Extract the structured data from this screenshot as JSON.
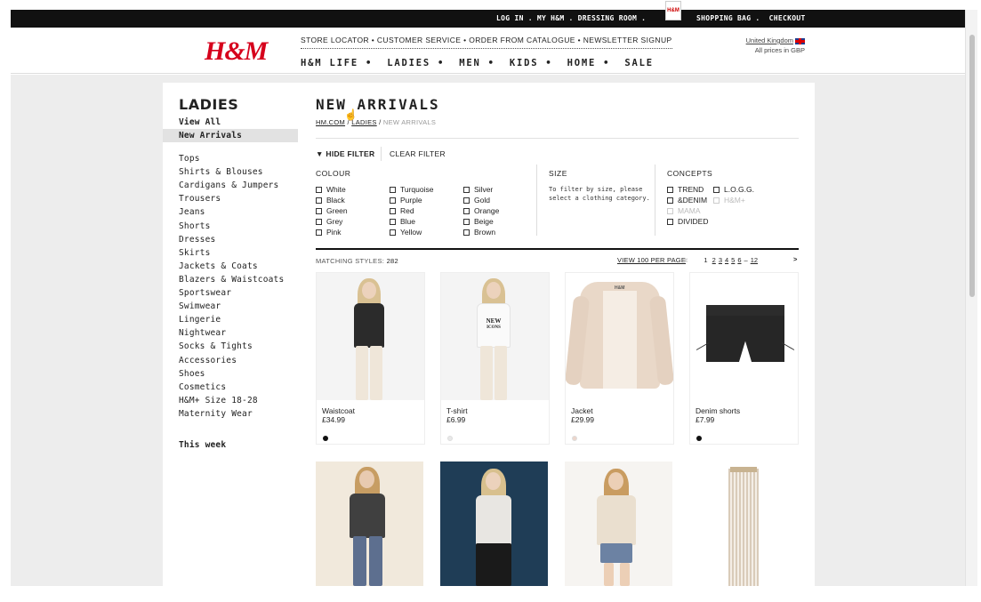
{
  "topbar": {
    "links": [
      "LOG IN",
      "MY H&M",
      "DRESSING ROOM"
    ],
    "bag_icon": "H&M",
    "right_links": [
      "SHOPPING BAG",
      "CHECKOUT"
    ]
  },
  "header": {
    "logo": "H&M",
    "subnav": "STORE LOCATOR • CUSTOMER SERVICE • ORDER FROM CATALOGUE • NEWSLETTER SIGNUP",
    "mainnav": [
      "H&M LIFE",
      "LADIES",
      "MEN",
      "KIDS",
      "HOME",
      "SALE"
    ],
    "mainnav_sep": "•",
    "country": "United Kingdom",
    "currency_note": "All prices in GBP"
  },
  "sidebar": {
    "title": "LADIES",
    "top_items": [
      "View All",
      "New Arrivals"
    ],
    "categories": [
      "Tops",
      "Shirts & Blouses",
      "Cardigans & Jumpers",
      "Trousers",
      "Jeans",
      "Shorts",
      "Dresses",
      "Skirts",
      "Jackets & Coats",
      "Blazers & Waistcoats",
      "Sportswear",
      "Swimwear",
      "Lingerie",
      "Nightwear",
      "Socks & Tights",
      "Accessories",
      "Shoes",
      "Cosmetics",
      "H&M+ Size 18-28",
      "Maternity Wear"
    ],
    "this_week": "This week"
  },
  "main": {
    "title": "NEW ARRIVALS",
    "breadcrumb": {
      "home": "HM.COM",
      "section": "LADIES",
      "sep": "/",
      "current": "NEW ARRIVALS"
    },
    "filter": {
      "hide_label": "▼ HIDE FILTER",
      "clear_label": "CLEAR FILTER",
      "colour_heading": "COLOUR",
      "colours": [
        "White",
        "Black",
        "Green",
        "Grey",
        "Pink",
        "Turquoise",
        "Purple",
        "Red",
        "Blue",
        "Yellow",
        "Silver",
        "Gold",
        "Orange",
        "Beige",
        "Brown"
      ],
      "size_heading": "SIZE",
      "size_note": "To filter by size, please select a clothing category.",
      "concepts_heading": "CONCEPTS",
      "concepts": [
        "TREND",
        "&DENIM",
        "MAMA",
        "DIVIDED",
        "L.O.G.G.",
        "H&M+"
      ]
    },
    "matching_label": "MATCHING STYLES:",
    "matching_count": "282",
    "per_page": "VIEW 100 PER PAGE",
    "pager": {
      "prev": "<",
      "pages": [
        "1",
        "2",
        "3",
        "4",
        "5",
        "6",
        "–",
        "12"
      ],
      "next": ">"
    },
    "products": [
      {
        "name": "Waistcoat",
        "price": "£34.99",
        "swatch": "#111111"
      },
      {
        "name": "T-shirt",
        "price": "£6.99",
        "swatch": "#e8e8e8"
      },
      {
        "name": "Jacket",
        "price": "£29.99",
        "swatch": "#ecd6cc"
      },
      {
        "name": "Denim shorts",
        "price": "£7.99",
        "swatch": "#111111"
      }
    ],
    "tshirt_print": [
      "NEW",
      "ICONS"
    ],
    "jacket_brand": "H&M"
  }
}
